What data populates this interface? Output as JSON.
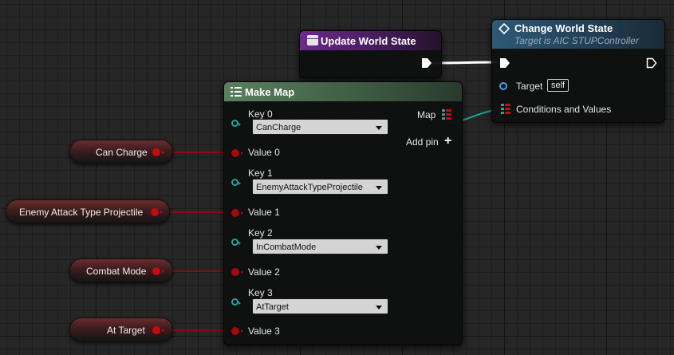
{
  "update_world_state": {
    "title": "Update World State"
  },
  "change_world_state": {
    "title": "Change World State",
    "subtitle": "Target is AIC STUPController",
    "target_label": "Target",
    "target_value": "self",
    "conditions_label": "Conditions and Values"
  },
  "make_map": {
    "title": "Make Map",
    "map_label": "Map",
    "add_pin_label": "Add pin",
    "entries": [
      {
        "key_label": "Key 0",
        "key_value": "CanCharge",
        "value_label": "Value 0"
      },
      {
        "key_label": "Key 1",
        "key_value": "EnemyAttackTypeProjectile",
        "value_label": "Value 1"
      },
      {
        "key_label": "Key 2",
        "key_value": "InCombatMode",
        "value_label": "Value 2"
      },
      {
        "key_label": "Key 3",
        "key_value": "AtTarget",
        "value_label": "Value 3"
      }
    ]
  },
  "variables": [
    "Can Charge",
    "Enemy Attack Type Projectile",
    "Combat Mode",
    "At Target"
  ],
  "colors": {
    "exec_wire": "#ffffff",
    "bool_wire": "#8c0a0e",
    "map_wire": "#17a7a1",
    "update_header": "#5c1d74",
    "change_header": "#23465c",
    "make_map_header": "#4d7050"
  }
}
